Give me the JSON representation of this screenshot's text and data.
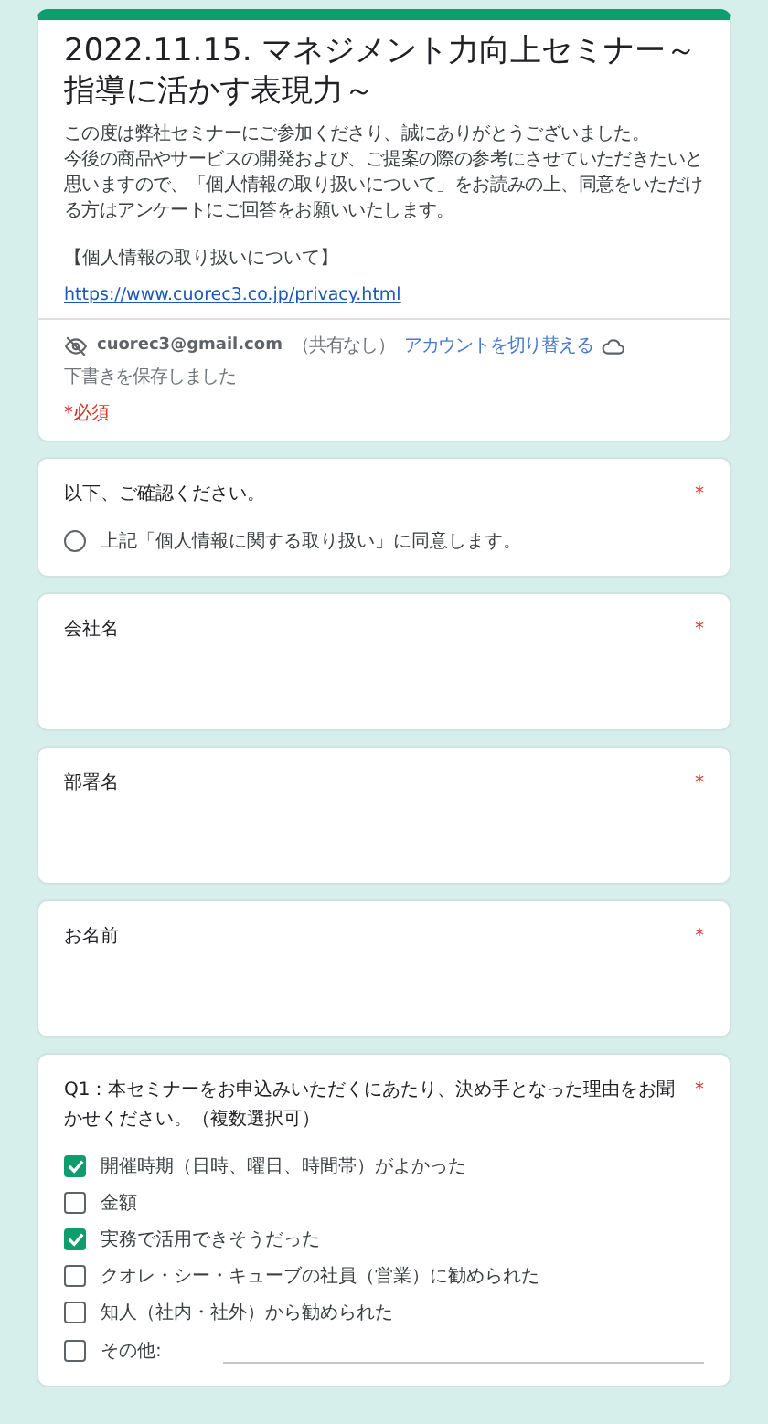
{
  "header": {
    "title": "2022.11.15.  マネジメント力向上セミナー～指導に活かす表現力～",
    "description": [
      "この度は弊社セミナーにご参加くださり、誠にありがとうございました。",
      "今後の商品やサービスの開発および、ご提案の際の参考にさせていただきたいと思いますので、「個人情報の取り扱いについて」をお読みの上、同意をいただける方はアンケートにご回答をお願いいたします。"
    ],
    "privacy_heading": "【個人情報の取り扱いについて】",
    "link": "https://www.cuorec3.co.jp/privacy.html",
    "account": {
      "email": "cuorec3@gmail.com",
      "sharing": "（共有なし）",
      "switch_link": "アカウントを切り替える",
      "draft_status": "下書きを保存しました"
    },
    "required_note": "*必須"
  },
  "required_mark": "*",
  "questions": [
    {
      "kind": "radio",
      "label": "以下、ご確認ください。",
      "required": true,
      "options": [
        {
          "label": "上記「個人情報に関する取り扱い」に同意します。",
          "selected": false
        }
      ]
    },
    {
      "kind": "text",
      "label": "会社名",
      "required": true
    },
    {
      "kind": "text",
      "label": "部署名",
      "required": true
    },
    {
      "kind": "text",
      "label": "お名前",
      "required": true
    },
    {
      "kind": "checkbox",
      "label": "Q1：本セミナーをお申込みいただくにあたり、決め手となった理由をお聞かせください。（複数選択可）",
      "required": true,
      "options": [
        {
          "label": "開催時期（日時、曜日、時間帯）がよかった",
          "checked": true
        },
        {
          "label": "金額",
          "checked": false
        },
        {
          "label": "実務で活用できそうだった",
          "checked": true
        },
        {
          "label": "クオレ・シー・キューブの社員（営業）に勧められた",
          "checked": false
        },
        {
          "label": "知人（社内・社外）から勧められた",
          "checked": false
        },
        {
          "label": "その他:",
          "checked": false,
          "other": true
        }
      ]
    }
  ]
}
